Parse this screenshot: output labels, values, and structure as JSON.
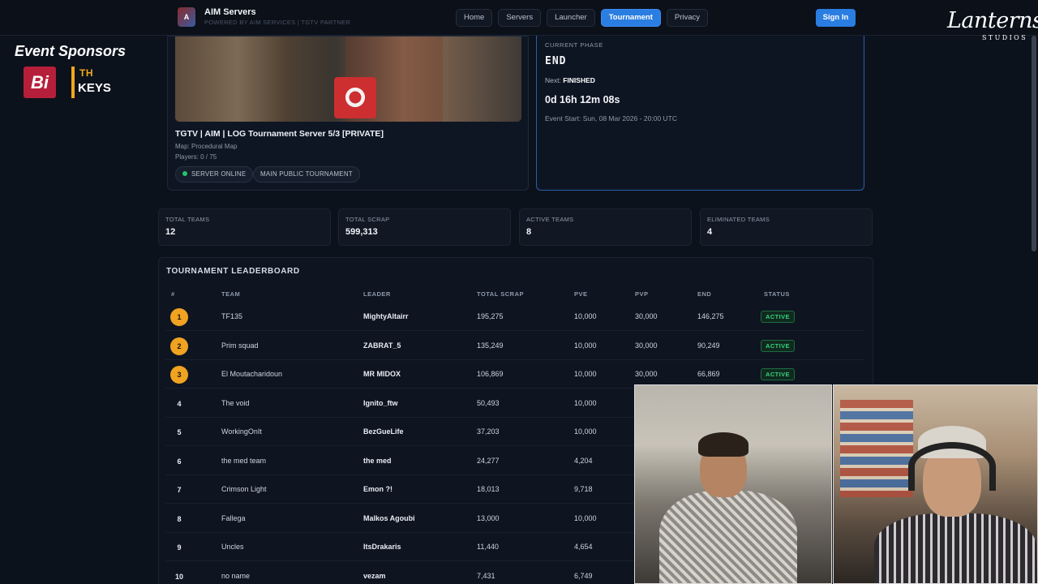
{
  "header": {
    "brand_title": "AIM Servers",
    "brand_sub": "POWERED BY AIM SERVICES | TGTV PARTNER",
    "nav": [
      {
        "label": "Home",
        "active": false
      },
      {
        "label": "Servers",
        "active": false
      },
      {
        "label": "Launcher",
        "active": false
      },
      {
        "label": "Tournament",
        "active": true
      },
      {
        "label": "Privacy",
        "active": false
      }
    ],
    "sign_in": "Sign In",
    "accent_color": "#2a7de1"
  },
  "overlay": {
    "studio_logo_line1": "Lanterns",
    "studio_logo_line2": "STUDIOS",
    "sponsors_title": "Event Sponsors",
    "sponsor_logos": [
      "Bi",
      "KEYS",
      "TH"
    ]
  },
  "server": {
    "name": "TGTV | AIM | LOG Tournament Server 5/3 [PRIVATE]",
    "map": "Map: Procedural Map",
    "players": "Players: 0 / 75",
    "status": "SERVER ONLINE",
    "tag": "MAIN PUBLIC TOURNAMENT"
  },
  "phase": {
    "label": "CURRENT PHASE",
    "value": "END",
    "next_prefix": "Next:",
    "next_value": "FINISHED",
    "timer": "0d 16h 12m 08s",
    "start": "Event Start: Sun, 08 Mar 2026 - 20:00 UTC"
  },
  "stats": [
    {
      "label": "TOTAL TEAMS",
      "value": "12"
    },
    {
      "label": "TOTAL SCRAP",
      "value": "599,313"
    },
    {
      "label": "ACTIVE TEAMS",
      "value": "8"
    },
    {
      "label": "ELIMINATED TEAMS",
      "value": "4"
    }
  ],
  "leaderboard": {
    "title": "TOURNAMENT LEADERBOARD",
    "columns": [
      "#",
      "TEAM",
      "LEADER",
      "TOTAL SCRAP",
      "PVE",
      "PVP",
      "END",
      "STATUS"
    ],
    "rows": [
      {
        "rank": "1",
        "team": "TF135",
        "leader": "MightyAltairr",
        "total": "195,275",
        "pve": "10,000",
        "pvp": "30,000",
        "end": "146,275",
        "status": "ACTIVE"
      },
      {
        "rank": "2",
        "team": "Prim squad",
        "leader": "ZABRAT_5",
        "total": "135,249",
        "pve": "10,000",
        "pvp": "30,000",
        "end": "90,249",
        "status": "ACTIVE"
      },
      {
        "rank": "3",
        "team": "El Moutacharidoun",
        "leader": "MR MIDOX",
        "total": "106,869",
        "pve": "10,000",
        "pvp": "30,000",
        "end": "66,869",
        "status": "ACTIVE"
      },
      {
        "rank": "4",
        "team": "The void",
        "leader": "Ignito_ftw",
        "total": "50,493",
        "pve": "10,000",
        "pvp": "",
        "end": "",
        "status": ""
      },
      {
        "rank": "5",
        "team": "WorkingOnIt",
        "leader": "BezGueLife",
        "total": "37,203",
        "pve": "10,000",
        "pvp": "",
        "end": "",
        "status": ""
      },
      {
        "rank": "6",
        "team": "the med team",
        "leader": "the med",
        "total": "24,277",
        "pve": "4,204",
        "pvp": "",
        "end": "",
        "status": ""
      },
      {
        "rank": "7",
        "team": "Crimson Light",
        "leader": "Emon ?!",
        "total": "18,013",
        "pve": "9,718",
        "pvp": "",
        "end": "",
        "status": ""
      },
      {
        "rank": "8",
        "team": "Fallega",
        "leader": "Malkos Agoubi",
        "total": "13,000",
        "pve": "10,000",
        "pvp": "",
        "end": "",
        "status": ""
      },
      {
        "rank": "9",
        "team": "Uncles",
        "leader": "ItsDrakaris",
        "total": "11,440",
        "pve": "4,654",
        "pvp": "",
        "end": "",
        "status": ""
      },
      {
        "rank": "10",
        "team": "no name",
        "leader": "vezam",
        "total": "7,431",
        "pve": "6,749",
        "pvp": "",
        "end": "",
        "status": ""
      }
    ]
  }
}
